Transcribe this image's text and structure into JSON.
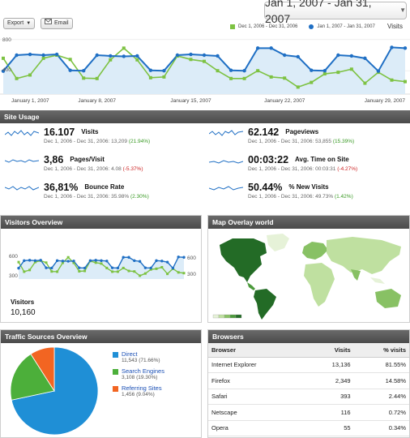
{
  "toolbar": {
    "export_label": "Export",
    "email_label": "Email"
  },
  "date_range": "Jan 1, 2007 - Jan 31, 2007",
  "main_chart": {
    "legend": [
      {
        "label": "Dec 1, 2006 - Dec 31, 2006",
        "color": "#7dc242"
      },
      {
        "label": "Jan 1, 2007 - Jan 31, 2007",
        "color": "#1f6fc4"
      }
    ],
    "metric_label": "Visits",
    "y_ticks": [
      "800",
      "400"
    ],
    "x_ticks": [
      "January 1, 2007",
      "January 8, 2007",
      "January 15, 2007",
      "January 22, 2007",
      "January 29, 2007"
    ]
  },
  "chart_data": {
    "type": "line",
    "x": [
      1,
      2,
      3,
      4,
      5,
      6,
      7,
      8,
      9,
      10,
      11,
      12,
      13,
      14,
      15,
      16,
      17,
      18,
      19,
      20,
      21,
      22,
      23,
      24,
      25,
      26,
      27,
      28,
      29,
      30,
      31
    ],
    "series": [
      {
        "name": "Jan 1, 2007 - Jan 31, 2007",
        "color": "#1f6fc4",
        "values": [
          395,
          600,
          610,
          600,
          610,
          405,
          400,
          600,
          590,
          585,
          590,
          405,
          400,
          600,
          610,
          600,
          590,
          405,
          400,
          690,
          690,
          600,
          580,
          405,
          400,
          600,
          590,
          560,
          395,
          700,
          690
        ]
      },
      {
        "name": "Dec 1, 2006 - Dec 31, 2006",
        "color": "#7dc242",
        "values": [
          560,
          300,
          345,
          560,
          600,
          545,
          305,
          300,
          540,
          690,
          540,
          310,
          320,
          590,
          545,
          520,
          400,
          300,
          300,
          400,
          320,
          305,
          190,
          250,
          360,
          380,
          420,
          240,
          380,
          280,
          260
        ]
      }
    ],
    "ylim": [
      100,
      850
    ]
  },
  "site_usage": {
    "title": "Site Usage",
    "metrics": [
      {
        "value": "16.107",
        "label": "Visits",
        "comp_prefix": "Dec 1, 2006 - Dec 31, 2006: 13,209",
        "change": "(21.94%)",
        "trend": "pos"
      },
      {
        "value": "62.142",
        "label": "Pageviews",
        "comp_prefix": "Dec 1, 2006 - Dec 31, 2006: 53,855",
        "change": "(15.39%)",
        "trend": "pos"
      },
      {
        "value": "3,86",
        "label": "Pages/Visit",
        "comp_prefix": "Dec 1, 2006 - Dec 31, 2006: 4.08",
        "change": "(-5.37%)",
        "trend": "neg"
      },
      {
        "value": "00:03:22",
        "label": "Avg. Time on Site",
        "comp_prefix": "Dec 1, 2006 - Dec 31, 2006: 00:03:31",
        "change": "(-4.27%)",
        "trend": "neg"
      },
      {
        "value": "36,81%",
        "label": "Bounce Rate",
        "comp_prefix": "Dec 1, 2006 - Dec 31, 2006: 35.98%",
        "change": "(2.30%)",
        "trend": "pos"
      },
      {
        "value": "50.44%",
        "label": "% New Visits",
        "comp_prefix": "Dec 1, 2006 - Dec 31, 2006: 49.73%",
        "change": "(1.42%)",
        "trend": "pos"
      }
    ]
  },
  "visitors_overview": {
    "title": "Visitors Overview",
    "y_left": [
      "600",
      "300"
    ],
    "y_right": [
      "600",
      "300"
    ],
    "label": "Visitors",
    "value": "10,160"
  },
  "map_overlay": {
    "title": "Map Overlay world",
    "legend_colors": [
      "#e6f2d8",
      "#bfe0a0",
      "#88c164",
      "#4c9a3c",
      "#236b26"
    ]
  },
  "traffic_sources": {
    "title": "Traffic Sources Overview",
    "items": [
      {
        "label": "Direct",
        "sub": "11,543 (71.66%)",
        "color": "#1f8fd6",
        "percent": 71.66
      },
      {
        "label": "Search Engines",
        "sub": "3,108 (19.30%)",
        "color": "#4caf3a",
        "percent": 19.3
      },
      {
        "label": "Referring Sites",
        "sub": "1,456 (9.04%)",
        "color": "#f26522",
        "percent": 9.04
      }
    ]
  },
  "browsers": {
    "title": "Browsers",
    "columns": [
      "Browser",
      "Visits",
      "% visits"
    ],
    "rows": [
      [
        "Internet Explorer",
        "13,136",
        "81.55%"
      ],
      [
        "Firefox",
        "2,349",
        "14.58%"
      ],
      [
        "Safari",
        "393",
        "2.44%"
      ],
      [
        "Netscape",
        "116",
        "0.72%"
      ],
      [
        "Opera",
        "55",
        "0.34%"
      ]
    ]
  }
}
